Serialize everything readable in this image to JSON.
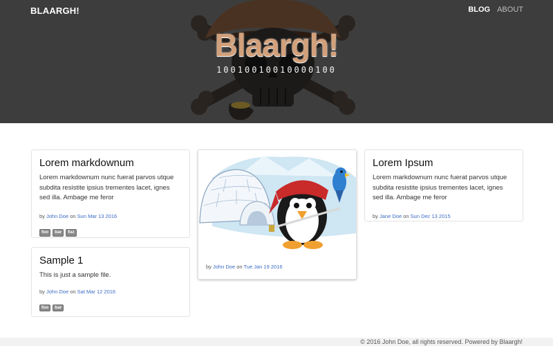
{
  "nav": {
    "brand": "BLAARGH!",
    "links": [
      "BLOG",
      "ABOUT"
    ]
  },
  "hero": {
    "title": "Blaargh!",
    "binary": "10010010010000100"
  },
  "posts": [
    {
      "title": "Lorem markdownum",
      "excerpt": "Lorem markdownum nunc fuerat parvos utque subdita resistite ipsius trementes lacet, ignes sed illa. Ambage me feror",
      "by": "by",
      "author": "John Doe",
      "on": "on",
      "date": "Sun Mar 13 2016",
      "tags": [
        "foo",
        "bar",
        "fuz"
      ]
    },
    {
      "title": "Sample 1",
      "excerpt": "This is just a sample file.",
      "by": "by",
      "author": "John Doe",
      "on": "on",
      "date": "Sat Mar 12 2016",
      "tags": [
        "foo",
        "bar"
      ]
    },
    {
      "by": "by",
      "author": "John Doe",
      "on": "on",
      "date": "Tue Jan 19 2016"
    },
    {
      "title": "Lorem Ipsum",
      "excerpt": "Lorem markdownum nunc fuerat parvos utque subdita resistite ipsius trementes lacet, ignes sed illa. Ambage me feror",
      "by": "by",
      "author": "Jane Doe",
      "on": "on",
      "date": "Sun Dec 13 2015"
    }
  ],
  "footer": {
    "text": "© 2016 John Doe, all rights reserved. Powered by Blaargh!"
  },
  "colors": {
    "header_bg": "#3d3d3d",
    "link": "#3a6bc4",
    "footer_bg": "#f2f2f2"
  }
}
